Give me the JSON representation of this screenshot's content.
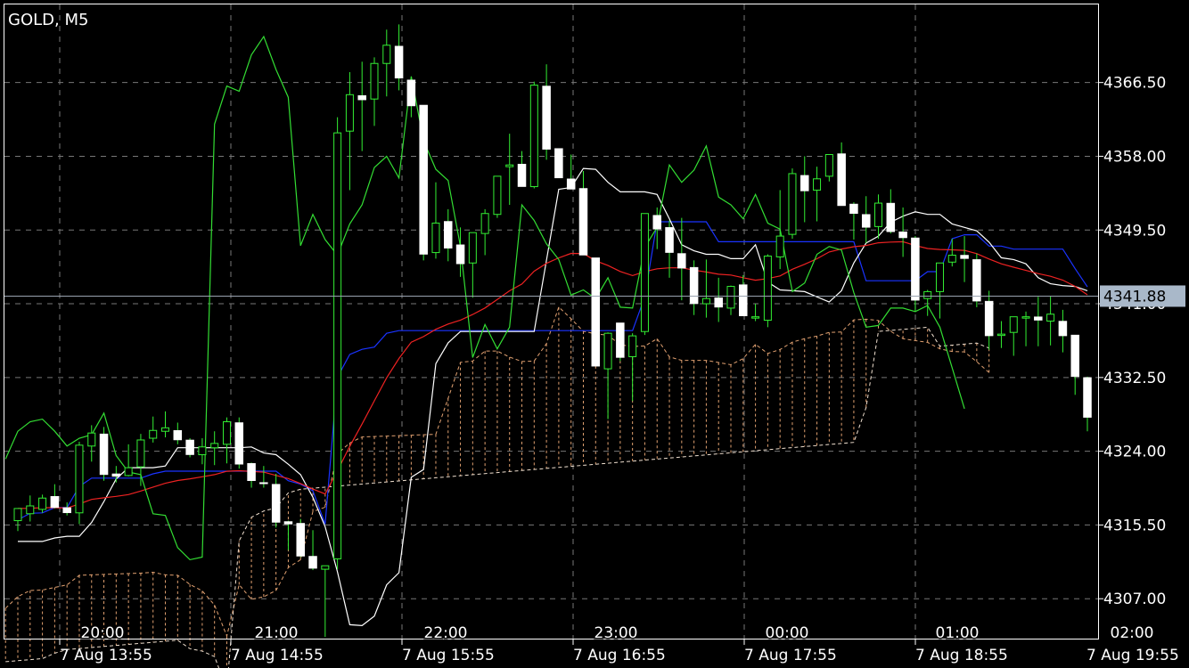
{
  "header": {
    "symbol_timeframe": "GOLD, M5"
  },
  "chart_data": {
    "type": "candlestick",
    "title": "GOLD, M5",
    "ylim": [
      4302.3,
      4375.5
    ],
    "y_ticks": [
      "4366.50",
      "4358.00",
      "4349.50",
      "4341.00",
      "4332.50",
      "4324.00",
      "4315.50",
      "4307.00"
    ],
    "current_price": "4341.88",
    "grid": true,
    "x_time_labels": [
      "20:00",
      "21:00",
      "22:00",
      "23:00",
      "00:00",
      "01:00",
      "02:00"
    ],
    "x_date_labels": [
      "7 Aug 13:55",
      "7 Aug 14:55",
      "7 Aug 15:55",
      "7 Aug 16:55",
      "7 Aug 17:55",
      "7 Aug 18:55",
      "7 Aug 19:55"
    ],
    "candles": [
      [
        4316.0,
        4317.4,
        4314.8,
        4317.4
      ],
      [
        4316.8,
        4318.9,
        4315.9,
        4317.7
      ],
      [
        4317.3,
        4319.0,
        4316.9,
        4318.6
      ],
      [
        4318.8,
        4320.2,
        4317.4,
        4317.5
      ],
      [
        4317.5,
        4318.1,
        4316.6,
        4316.9
      ],
      [
        4316.9,
        4325.1,
        4315.6,
        4324.7
      ],
      [
        4324.6,
        4327.0,
        4322.8,
        4326.1
      ],
      [
        4326.0,
        4326.8,
        4320.6,
        4321.3
      ],
      [
        4321.4,
        4322.3,
        4320.4,
        4321.1
      ],
      [
        4321.2,
        4324.8,
        4321.1,
        4322.1
      ],
      [
        4322.2,
        4326.0,
        4320.0,
        4325.3
      ],
      [
        4325.5,
        4328.0,
        4325.0,
        4326.4
      ],
      [
        4326.3,
        4328.6,
        4325.6,
        4326.7
      ],
      [
        4326.4,
        4327.3,
        4324.8,
        4325.3
      ],
      [
        4325.3,
        4325.5,
        4323.3,
        4323.6
      ],
      [
        4323.6,
        4325.5,
        4322.5,
        4324.5
      ],
      [
        4324.4,
        4326.3,
        4322.4,
        4324.9
      ],
      [
        4324.8,
        4327.9,
        4322.6,
        4327.4
      ],
      [
        4327.3,
        4327.9,
        4322.0,
        4322.5
      ],
      [
        4322.6,
        4322.7,
        4319.8,
        4320.6
      ],
      [
        4320.4,
        4322.3,
        4319.8,
        4320.3
      ],
      [
        4320.2,
        4321.4,
        4315.2,
        4315.8
      ],
      [
        4315.9,
        4316.0,
        4312.6,
        4315.6
      ],
      [
        4315.7,
        4316.2,
        4311.8,
        4311.9
      ],
      [
        4311.9,
        4314.9,
        4310.3,
        4310.5
      ],
      [
        4310.4,
        4310.4,
        4302.6,
        4310.8
      ],
      [
        4311.6,
        4362.5,
        4310.4,
        4360.7
      ],
      [
        4360.9,
        4367.7,
        4354.1,
        4365.1
      ],
      [
        4365.0,
        4368.9,
        4358.6,
        4364.5
      ],
      [
        4364.6,
        4369.4,
        4361.5,
        4368.7
      ],
      [
        4368.7,
        4372.6,
        4364.9,
        4370.8
      ],
      [
        4370.7,
        4373.2,
        4365.6,
        4367.0
      ],
      [
        4366.8,
        4366.6,
        4362.5,
        4363.8
      ],
      [
        4363.9,
        4363.9,
        4346.0,
        4346.7
      ],
      [
        4346.9,
        4355.0,
        4346.2,
        4350.3
      ],
      [
        4350.5,
        4351.9,
        4345.9,
        4347.4
      ],
      [
        4347.8,
        4349.8,
        4344.1,
        4345.6
      ],
      [
        4345.7,
        4349.0,
        4341.7,
        4349.2
      ],
      [
        4349.1,
        4351.9,
        4346.6,
        4351.4
      ],
      [
        4351.3,
        4355.1,
        4350.9,
        4355.7
      ],
      [
        4356.8,
        4360.6,
        4352.4,
        4357.0
      ],
      [
        4357.1,
        4358.6,
        4355.9,
        4354.5
      ],
      [
        4354.5,
        4366.6,
        4354.3,
        4366.2
      ],
      [
        4366.1,
        4368.6,
        4357.6,
        4358.8
      ],
      [
        4358.9,
        4358.9,
        4355.5,
        4355.5
      ],
      [
        4355.4,
        4358.2,
        4354.8,
        4354.2
      ],
      [
        4354.3,
        4356.3,
        4350.1,
        4346.6
      ],
      [
        4346.3,
        4346.3,
        4333.9,
        4333.8
      ],
      [
        4333.5,
        4337.7,
        4327.7,
        4337.6
      ],
      [
        4338.8,
        4338.4,
        4334.4,
        4334.8
      ],
      [
        4334.9,
        4337.6,
        4329.8,
        4337.3
      ],
      [
        4337.8,
        4349.2,
        4337.4,
        4351.4
      ],
      [
        4351.2,
        4352.1,
        4347.3,
        4349.6
      ],
      [
        4349.8,
        4350.6,
        4344.0,
        4346.9
      ],
      [
        4346.8,
        4350.9,
        4341.4,
        4345.1
      ],
      [
        4345.2,
        4346.0,
        4339.7,
        4341.0
      ],
      [
        4341.0,
        4346.1,
        4339.4,
        4341.6
      ],
      [
        4341.7,
        4344.0,
        4338.9,
        4340.6
      ],
      [
        4340.5,
        4343.1,
        4339.7,
        4343.0
      ],
      [
        4343.2,
        4344.3,
        4340.1,
        4339.6
      ],
      [
        4339.5,
        4341.0,
        4339.0,
        4339.5
      ],
      [
        4339.1,
        4346.7,
        4338.3,
        4346.5
      ],
      [
        4346.4,
        4354.1,
        4345.0,
        4348.8
      ],
      [
        4349.0,
        4356.6,
        4348.5,
        4356.0
      ],
      [
        4355.8,
        4358.0,
        4350.4,
        4354.0
      ],
      [
        4354.1,
        4356.8,
        4350.5,
        4355.4
      ],
      [
        4355.7,
        4357.6,
        4355.1,
        4358.2
      ],
      [
        4358.3,
        4359.6,
        4357.4,
        4352.3
      ],
      [
        4352.5,
        4352.7,
        4348.4,
        4351.4
      ],
      [
        4351.3,
        4353.4,
        4348.0,
        4349.8
      ],
      [
        4349.9,
        4353.6,
        4348.5,
        4352.6
      ],
      [
        4352.6,
        4354.2,
        4349.1,
        4349.3
      ],
      [
        4349.3,
        4352.1,
        4346.4,
        4348.6
      ],
      [
        4348.6,
        4348.8,
        4340.1,
        4341.4
      ],
      [
        4341.6,
        4342.6,
        4339.6,
        4342.4
      ],
      [
        4342.4,
        4345.6,
        4339.3,
        4345.7
      ],
      [
        4345.8,
        4348.5,
        4345.3,
        4346.6
      ],
      [
        4346.6,
        4348.8,
        4343.5,
        4346.2
      ],
      [
        4346.1,
        4346.8,
        4340.6,
        4341.3
      ],
      [
        4341.3,
        4342.5,
        4335.7,
        4337.3
      ],
      [
        4337.4,
        4339.0,
        4335.9,
        4337.5
      ],
      [
        4337.7,
        4339.2,
        4335.0,
        4339.5
      ],
      [
        4339.4,
        4340.1,
        4336.1,
        4339.5
      ],
      [
        4339.5,
        4341.8,
        4336.1,
        4339.1
      ],
      [
        4339.0,
        4341.9,
        4336.2,
        4339.8
      ],
      [
        4339.0,
        4340.3,
        4335.4,
        4337.3
      ],
      [
        4337.4,
        4337.4,
        4330.5,
        4332.6
      ],
      [
        4332.5,
        4332.6,
        4326.3,
        4327.9
      ]
    ],
    "tenkan": [
      4313.6,
      4313.6,
      4313.6,
      4314.0,
      4314.2,
      4314.2,
      4315.8,
      4318.2,
      4320.8,
      4322.1,
      4322.1,
      4322.1,
      4322.3,
      4324.4,
      4324.4,
      4324.4,
      4324.4,
      4324.4,
      4324.4,
      4324.5,
      4323.8,
      4323.6,
      4322.5,
      4321.3,
      4318.7,
      4315.3,
      4310.1,
      4304.0,
      4303.9,
      4305.0,
      4308.6,
      4310.0,
      4321.0,
      4321.9,
      4334.1,
      4336.5,
      4337.8,
      4337.8,
      4337.8,
      4337.8,
      4337.8,
      4337.8,
      4337.8,
      4346.0,
      4354.2,
      4354.4,
      4356.6,
      4356.5,
      4355.0,
      4353.9,
      4353.9,
      4353.9,
      4353.6,
      4350.8,
      4347.8,
      4347.1,
      4346.7,
      4346.7,
      4346.2,
      4346.2,
      4347.8,
      4343.5,
      4342.6,
      4342.5,
      4342.4,
      4341.8,
      4341.2,
      4342.5,
      4345.7,
      4348.0,
      4348.8,
      4350.4,
      4351.1,
      4351.6,
      4351.3,
      4351.3,
      4350.2,
      4349.8,
      4349.4,
      4348.1,
      4346.3,
      4346.1,
      4345.6,
      4344.0,
      4343.3,
      4343.1,
      4343.0,
      4342.5,
      4342.1,
      4341.7,
      4339.8
    ]
  }
}
